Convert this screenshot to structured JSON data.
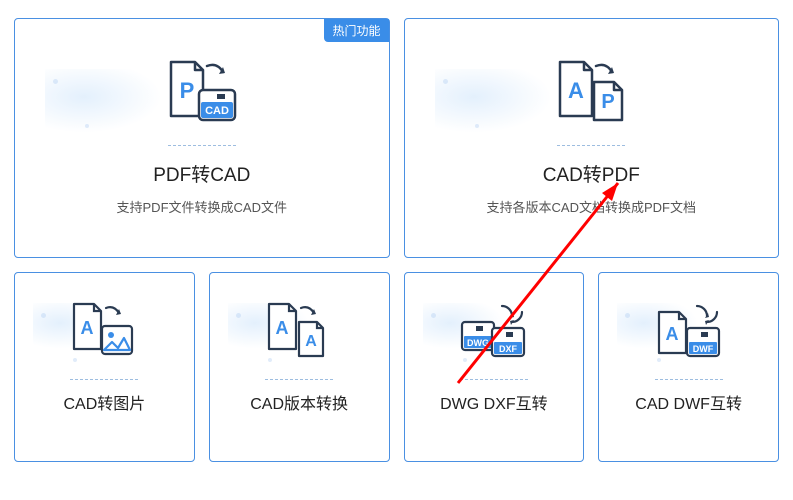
{
  "badge": "热门功能",
  "cards_top": [
    {
      "title": "PDF转CAD",
      "desc": "支持PDF文件转换成CAD文件",
      "badge": true
    },
    {
      "title": "CAD转PDF",
      "desc": "支持各版本CAD文档转换成PDF文档",
      "badge": false
    }
  ],
  "cards_bottom": [
    {
      "title": "CAD转图片"
    },
    {
      "title": "CAD版本转换"
    },
    {
      "title": "DWG DXF互转"
    },
    {
      "title": "CAD DWF互转"
    }
  ],
  "colors": {
    "border": "#4a90e2",
    "badge_bg": "#3a8de8",
    "arrow": "#ff0000"
  }
}
